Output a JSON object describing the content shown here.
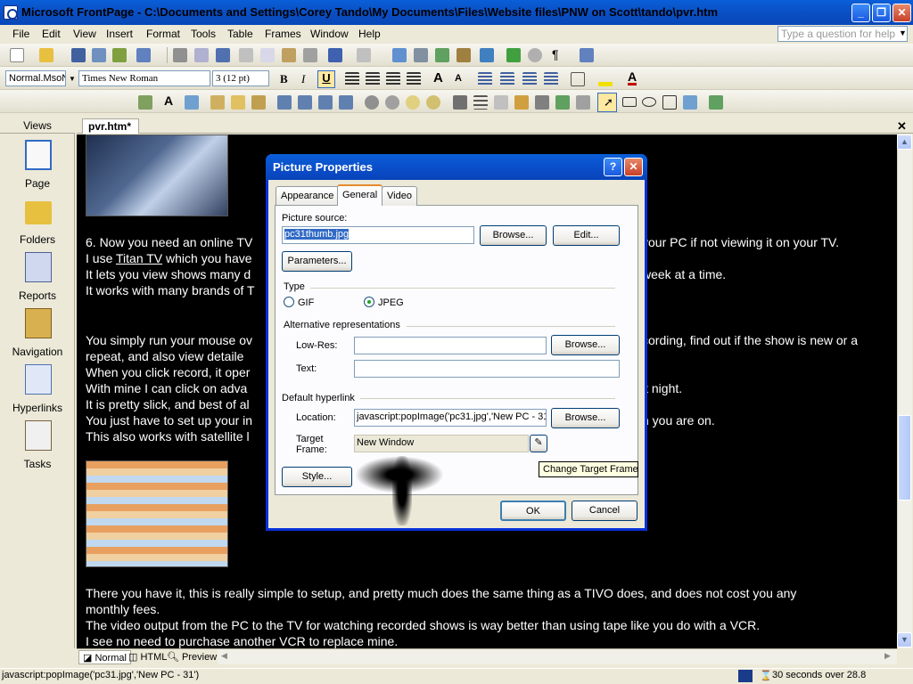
{
  "window": {
    "title": "Microsoft FrontPage - C:\\Documents and Settings\\Corey Tando\\My Documents\\Files\\Website files\\PNW on Scott\\tando\\pvr.htm",
    "minimize_icon": "minimize-icon",
    "restore_icon": "restore-icon",
    "close_icon": "close-icon"
  },
  "menu": {
    "items": [
      "File",
      "Edit",
      "View",
      "Insert",
      "Format",
      "Tools",
      "Table",
      "Frames",
      "Window",
      "Help"
    ],
    "help_placeholder": "Type a question for help"
  },
  "formatting": {
    "style": "Normal.MsoN",
    "font": "Times New Roman",
    "size": "3  (12 pt)"
  },
  "views": {
    "header": "Views",
    "items": [
      "Page",
      "Folders",
      "Reports",
      "Navigation",
      "Hyperlinks",
      "Tasks"
    ]
  },
  "doc": {
    "tab": "pvr.htm*",
    "lines": [
      "6. Now you need an online TV",
      "your PC if not viewing it on your TV.",
      "I use",
      "Titan TV",
      "which you have",
      "It lets you view shows many d",
      "week at a time.",
      "It works with many brands of T",
      "You simply run your mouse ov",
      "cording, find out if the show is new or a",
      "repeat, and also view detaile",
      "When you click record, it oper",
      "With mine I can click on adva",
      "it night.",
      "It is pretty slick, and best of al",
      "You just have to set up your in",
      "n you are on.",
      "This also works with satellite l",
      " There you have it, this is really simple to setup, and pretty much does the same thing as a TIVO does, and does not cost you any",
      "monthly fees.",
      "The video output from the PC to the TV for watching recorded shows is way better than using tape like you do with a VCR.",
      "I see no need to purchase another VCR to replace mine."
    ]
  },
  "viewtabs": [
    "Normal",
    "HTML",
    "Preview"
  ],
  "status": {
    "text": "javascript:popImage('pc31.jpg','New PC - 31')",
    "time": "30 seconds over 28.8"
  },
  "dialog": {
    "title": "Picture Properties",
    "tabs": [
      "Appearance",
      "General",
      "Video"
    ],
    "picture_source_label": "Picture source:",
    "picture_source_value": "pc31thumb.jpg",
    "browse_label": "Browse...",
    "edit_label": "Edit...",
    "parameters_label": "Parameters...",
    "type_label": "Type",
    "gif_label": "GIF",
    "jpeg_label": "JPEG",
    "alt_label": "Alternative representations",
    "lowres_label": "Low-Res:",
    "lowres_value": "",
    "text_label": "Text:",
    "text_value": "",
    "hyperlink_label": "Default hyperlink",
    "location_label": "Location:",
    "location_value": "javascript:popImage('pc31.jpg','New PC - 31",
    "target_label_1": "Target",
    "target_label_2": "Frame:",
    "target_value": "New Window",
    "style_label": "Style...",
    "ok_label": "OK",
    "cancel_label": "Cancel",
    "tooltip": "Change Target Frame"
  }
}
